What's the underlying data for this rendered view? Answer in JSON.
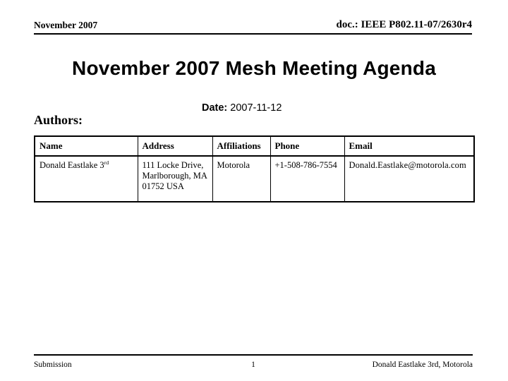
{
  "document": {
    "slide_kind": "ieee-802-11-submission-slide",
    "background_color": "#ffffff",
    "text_color": "#000000"
  },
  "header": {
    "left": "November 2007",
    "right": "doc.: IEEE P802.11-07/2630r4"
  },
  "title": "November 2007 Mesh Meeting Agenda",
  "date": {
    "label": "Date:",
    "value": "2007-11-12",
    "full": "Date: 2007-11-12"
  },
  "authors_section": {
    "label": "Authors:",
    "table": {
      "columns": [
        "Name",
        "Address",
        "Affiliations",
        "Phone",
        "Email"
      ],
      "rows": [
        {
          "name_base": "Donald Eastlake 3",
          "name_ordinal": "rd",
          "name_full": "Donald Eastlake 3rd",
          "address_lines": [
            "111 Locke Drive,",
            "Marlborough, MA",
            "01752 USA"
          ],
          "affiliations": "Motorola",
          "phone": "+1-508-786-7554",
          "email": "Donald.Eastlake@motorola.com"
        }
      ]
    }
  },
  "footer": {
    "left": "Submission",
    "page_number": "1",
    "right": "Donald Eastlake 3rd, Motorola"
  }
}
